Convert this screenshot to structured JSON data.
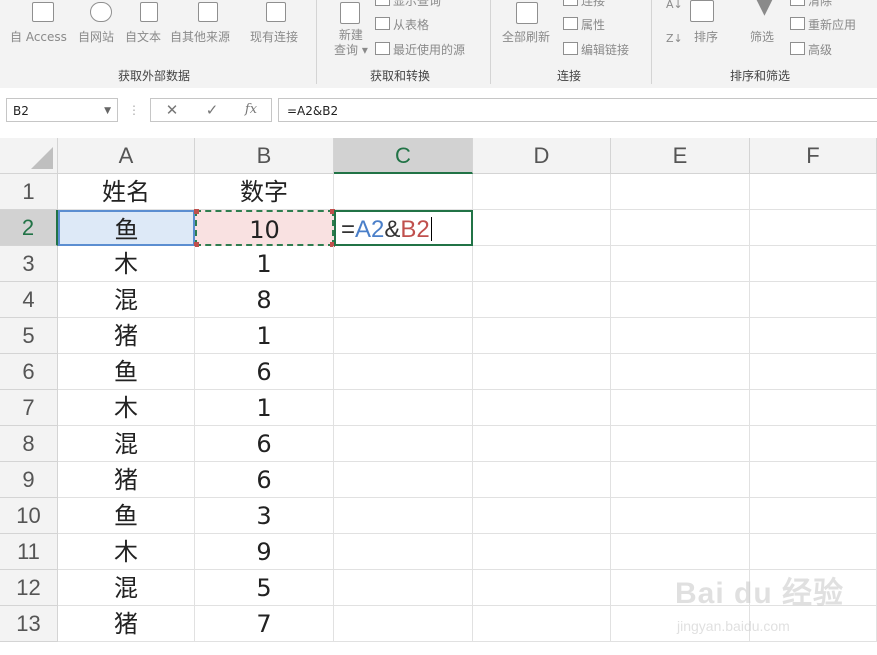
{
  "ribbon": {
    "get_external": {
      "buttons": [
        {
          "label": "自 Access",
          "icon": "access-icon"
        },
        {
          "label": "自网站",
          "icon": "web-icon"
        },
        {
          "label": "自文本",
          "icon": "text-file-icon"
        },
        {
          "label": "自其他来源",
          "icon": "other-sources-icon"
        }
      ],
      "group_label": "获取外部数据"
    },
    "existing_connections": {
      "label": "现有连接",
      "icon": "existing-connections-icon"
    },
    "get_transform": {
      "new_query": {
        "label_line1": "新建",
        "label_line2": "查询 ▾",
        "icon": "new-query-icon"
      },
      "items": [
        {
          "label": "显示查询",
          "icon": "show-queries-icon"
        },
        {
          "label": "从表格",
          "icon": "from-table-icon"
        },
        {
          "label": "最近使用的源",
          "icon": "recent-sources-icon"
        }
      ],
      "group_label": "获取和转换"
    },
    "connections": {
      "refresh_all": {
        "label": "全部刷新",
        "icon": "refresh-all-icon"
      },
      "items": [
        {
          "label": "连接",
          "icon": "connections-icon"
        },
        {
          "label": "属性",
          "icon": "properties-icon"
        },
        {
          "label": "编辑链接",
          "icon": "edit-links-icon"
        }
      ],
      "group_label": "连接"
    },
    "sort_filter": {
      "sort": {
        "label": "排序",
        "icon": "sort-icon"
      },
      "filter": {
        "label": "筛选",
        "icon": "filter-icon"
      },
      "items": [
        {
          "label": "清除",
          "icon": "clear-filter-icon"
        },
        {
          "label": "重新应用",
          "icon": "reapply-icon"
        },
        {
          "label": "高级",
          "icon": "advanced-filter-icon"
        }
      ],
      "group_label": "排序和筛选"
    }
  },
  "formula_bar": {
    "name_box": "B2",
    "cancel_glyph": "✕",
    "enter_glyph": "✓",
    "fx_glyph": "fx",
    "formula": "=A2&B2"
  },
  "sheet": {
    "columns": [
      "A",
      "B",
      "C",
      "D",
      "E",
      "F"
    ],
    "selected_column": "C",
    "selected_row": "2",
    "rows": [
      {
        "num": "1",
        "a": "姓名",
        "b": "数字"
      },
      {
        "num": "2",
        "a": "鱼",
        "b": "10"
      },
      {
        "num": "3",
        "a": "木",
        "b": "1"
      },
      {
        "num": "4",
        "a": "混",
        "b": "8"
      },
      {
        "num": "5",
        "a": "猪",
        "b": "1"
      },
      {
        "num": "6",
        "a": "鱼",
        "b": "6"
      },
      {
        "num": "7",
        "a": "木",
        "b": "1"
      },
      {
        "num": "8",
        "a": "混",
        "b": "6"
      },
      {
        "num": "9",
        "a": "猪",
        "b": "6"
      },
      {
        "num": "10",
        "a": "鱼",
        "b": "3"
      },
      {
        "num": "11",
        "a": "木",
        "b": "9"
      },
      {
        "num": "12",
        "a": "混",
        "b": "5"
      },
      {
        "num": "13",
        "a": "猪",
        "b": "7"
      }
    ],
    "editing_cell": {
      "eq": "=",
      "ref_a": "A2",
      "amp": "&",
      "ref_b": "B2"
    }
  },
  "watermark": {
    "logo": "Bai du 经验",
    "url": "jingyan.baidu.com"
  },
  "colors": {
    "accent_green": "#217346",
    "ref_blue": "#4a7fc9",
    "ref_red": "#c0504d"
  }
}
